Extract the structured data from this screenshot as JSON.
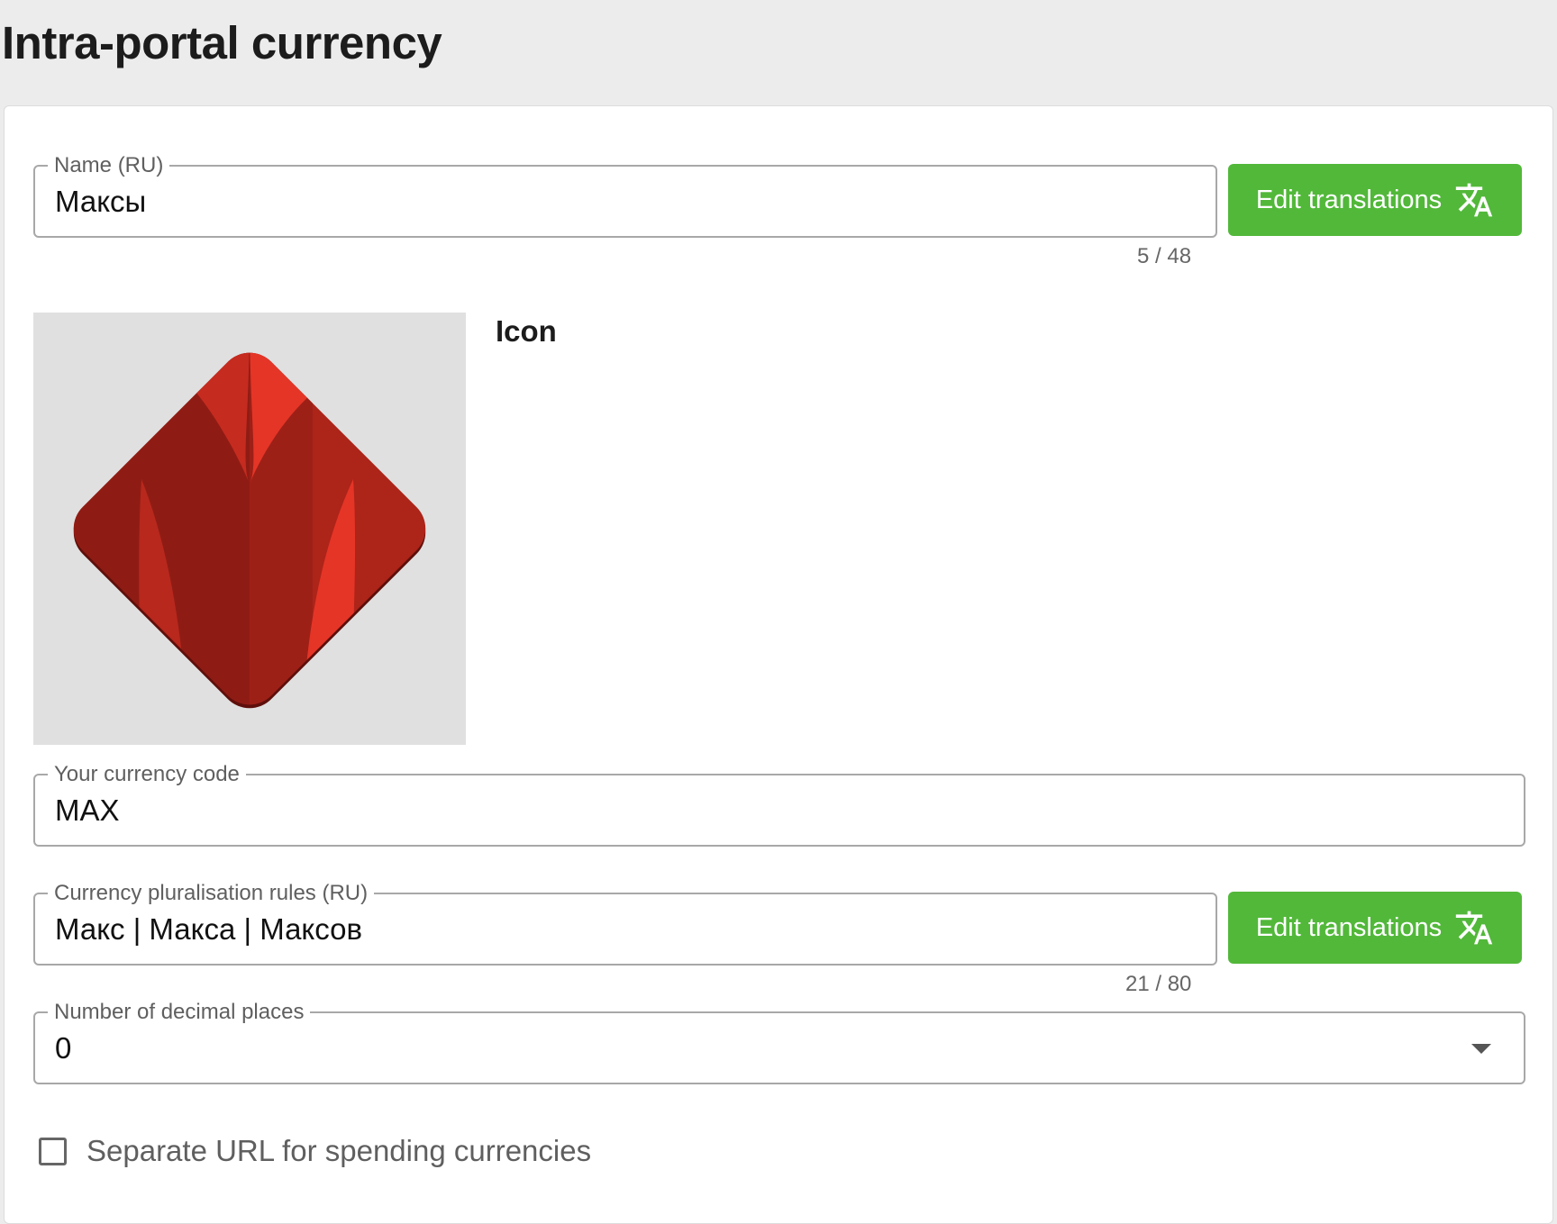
{
  "page": {
    "title": "Intra-portal currency"
  },
  "name_field": {
    "label": "Name (RU)",
    "value": "Максы",
    "counter": "5 / 48"
  },
  "translate_button_label": "Edit translations",
  "icon_section": {
    "label": "Icon",
    "image": "red-gem-currency-icon"
  },
  "currency_code_field": {
    "label": "Your currency code",
    "value": "MAX"
  },
  "plural_field": {
    "label": "Currency pluralisation rules (RU)",
    "value": "Макс | Макса | Максов",
    "counter": "21 / 80"
  },
  "decimal_field": {
    "label": "Number of decimal places",
    "value": "0"
  },
  "separate_url_checkbox": {
    "label": "Separate URL for spending currencies",
    "checked": false
  },
  "colors": {
    "accent_button": "#52b83a",
    "page_background": "#ececec",
    "gem_primary": "#b3241a",
    "gem_highlight": "#e53527"
  }
}
